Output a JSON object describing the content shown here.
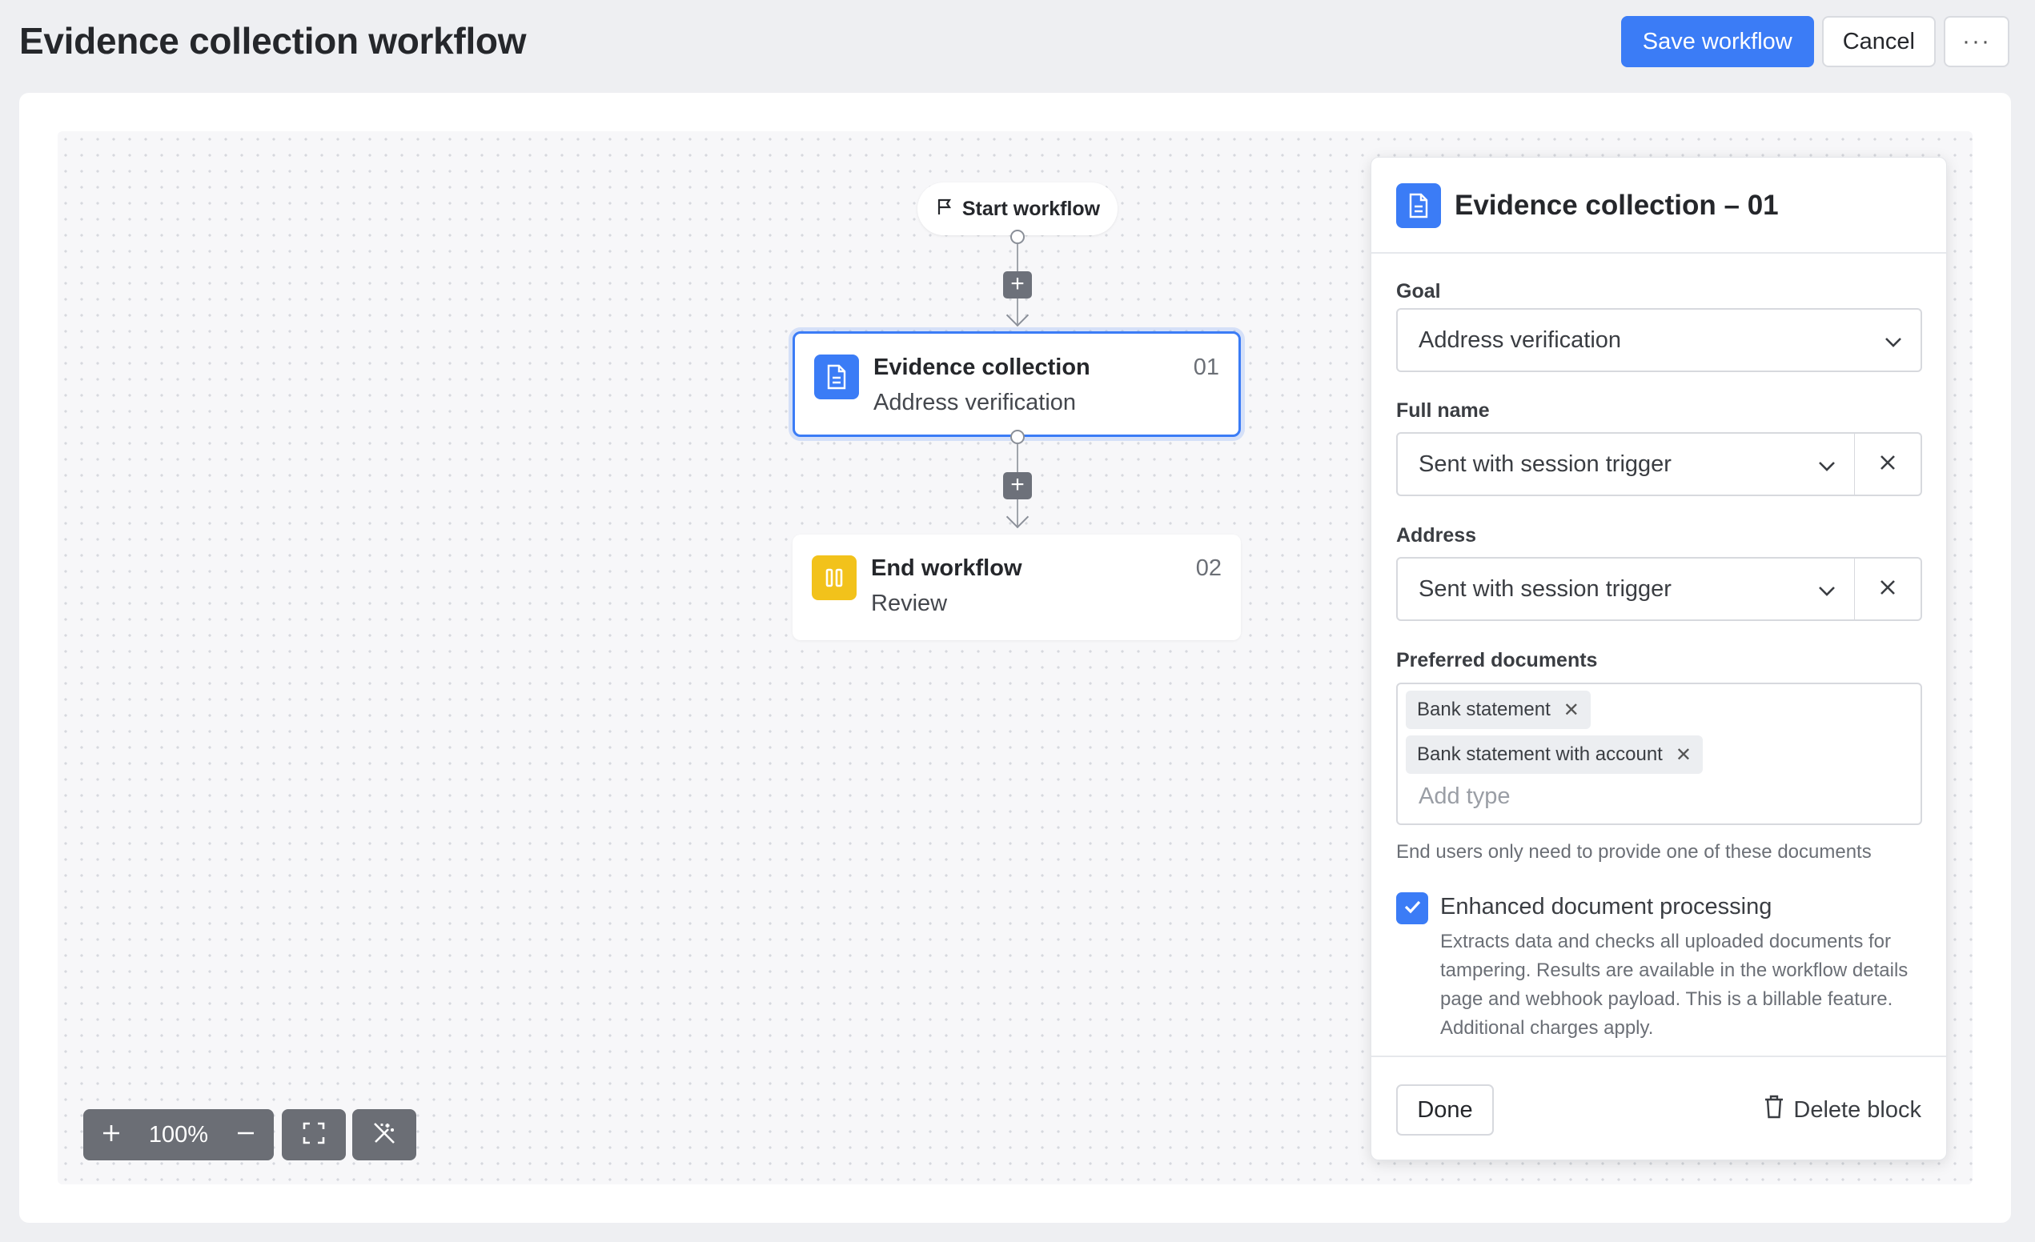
{
  "header": {
    "title": "Evidence collection workflow",
    "save_label": "Save workflow",
    "cancel_label": "Cancel",
    "more_label": "···"
  },
  "workflow": {
    "start_label": "Start workflow",
    "nodes": [
      {
        "title": "Evidence collection",
        "subtitle": "Address verification",
        "number": "01",
        "icon": "document-icon",
        "color": "#3b7cf6"
      },
      {
        "title": "End workflow",
        "subtitle": "Review",
        "number": "02",
        "icon": "end-icon",
        "color": "#f2c21b"
      }
    ]
  },
  "toolbar": {
    "zoom_level": "100%"
  },
  "panel": {
    "title": "Evidence collection – 01",
    "goal_label": "Goal",
    "goal_value": "Address verification",
    "fullname_label": "Full name",
    "fullname_value": "Sent with session trigger",
    "address_label": "Address",
    "address_value": "Sent with session trigger",
    "preferred_label": "Preferred documents",
    "tags": [
      "Bank statement",
      "Bank statement with account"
    ],
    "add_type_placeholder": "Add type",
    "hint": "End users only need to provide one of these documents",
    "enhanced_label": "Enhanced document processing",
    "enhanced_checked": true,
    "enhanced_desc": "Extracts data and checks all uploaded documents for tampering. Results are available in the workflow details page and webhook payload. This is a billable feature. Additional charges apply.",
    "done_label": "Done",
    "delete_label": "Delete block"
  }
}
